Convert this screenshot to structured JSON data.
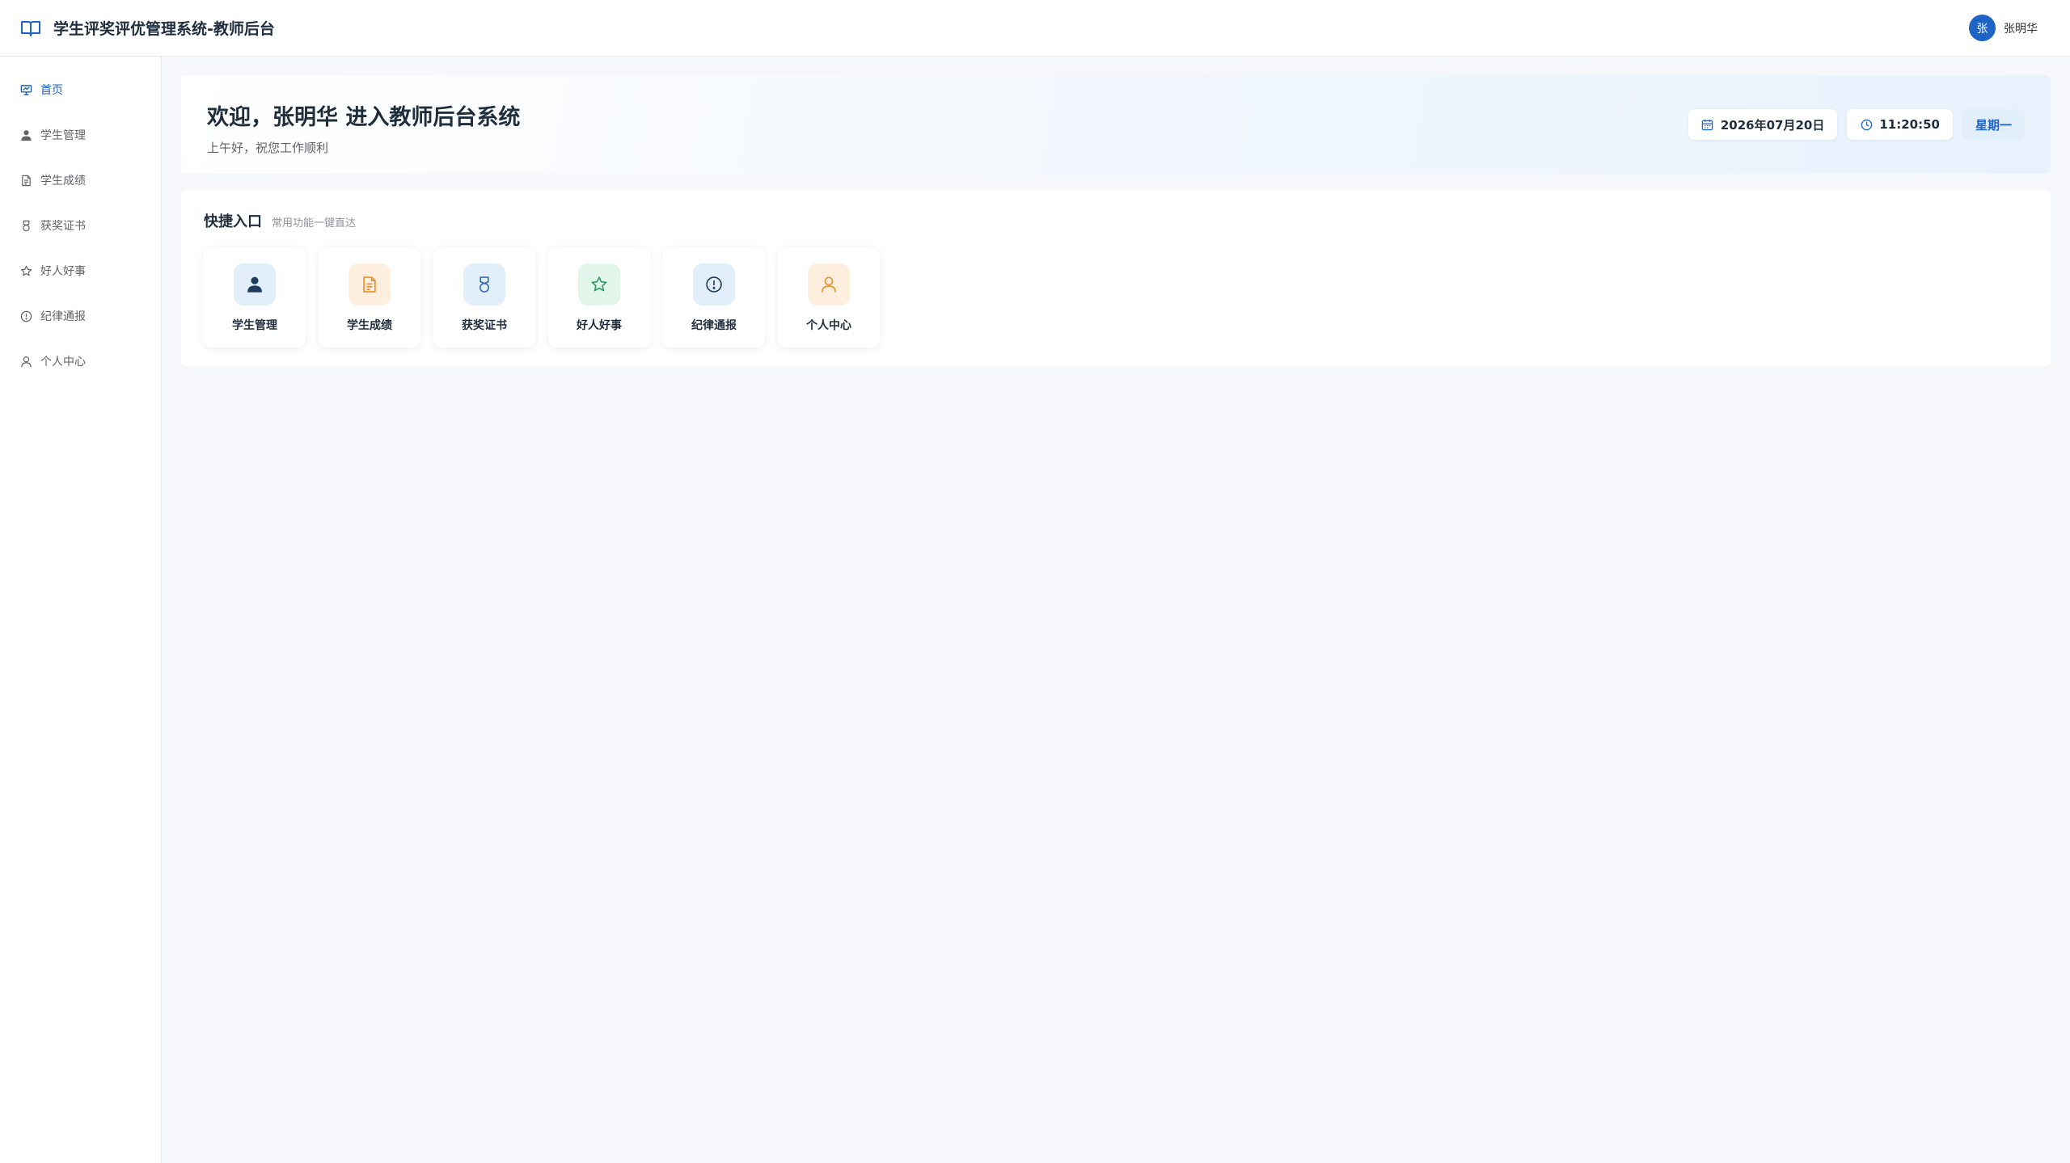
{
  "header": {
    "title": "学生评奖评优管理系统-教师后台",
    "logo_icon": "open-book-icon",
    "user": {
      "avatar_text": "张",
      "name": "张明华"
    }
  },
  "sidebar": {
    "items": [
      {
        "label": "首页",
        "icon": "dashboard-icon",
        "active": true
      },
      {
        "label": "学生管理",
        "icon": "user-filled-icon"
      },
      {
        "label": "学生成绩",
        "icon": "document-icon"
      },
      {
        "label": "获奖证书",
        "icon": "medal-icon"
      },
      {
        "label": "好人好事",
        "icon": "star-icon"
      },
      {
        "label": "纪律通报",
        "icon": "warning-icon"
      },
      {
        "label": "个人中心",
        "icon": "user-outline-icon"
      }
    ]
  },
  "welcome": {
    "title": "欢迎，张明华 进入教师后台系统",
    "subtitle": "上午好，祝您工作顺利",
    "date": "2026年07月20日",
    "time": "11:20:50",
    "weekday": "星期一"
  },
  "quick": {
    "title": "快捷入口",
    "subtitle": "常用功能一键直达",
    "items": [
      {
        "label": "学生管理",
        "icon": "user-filled-icon",
        "bg": "#e3eefb",
        "color": "#1f3a5f"
      },
      {
        "label": "学生成绩",
        "icon": "document-icon",
        "bg": "#fdeedd",
        "color": "#e6922f"
      },
      {
        "label": "获奖证书",
        "icon": "medal-icon",
        "bg": "#e3eefb",
        "color": "#3a6fb0"
      },
      {
        "label": "好人好事",
        "icon": "star-icon",
        "bg": "#e3f6ec",
        "color": "#2f9b62"
      },
      {
        "label": "纪律通报",
        "icon": "warning-icon",
        "bg": "#e3eefb",
        "color": "#1f3a5f"
      },
      {
        "label": "个人中心",
        "icon": "user-outline-icon",
        "bg": "#fdeedd",
        "color": "#e6922f"
      }
    ]
  },
  "colors": {
    "primary": "#1e63c6",
    "text": "#1f2d3d",
    "muted": "#606266",
    "background": "#f5f7fa"
  }
}
